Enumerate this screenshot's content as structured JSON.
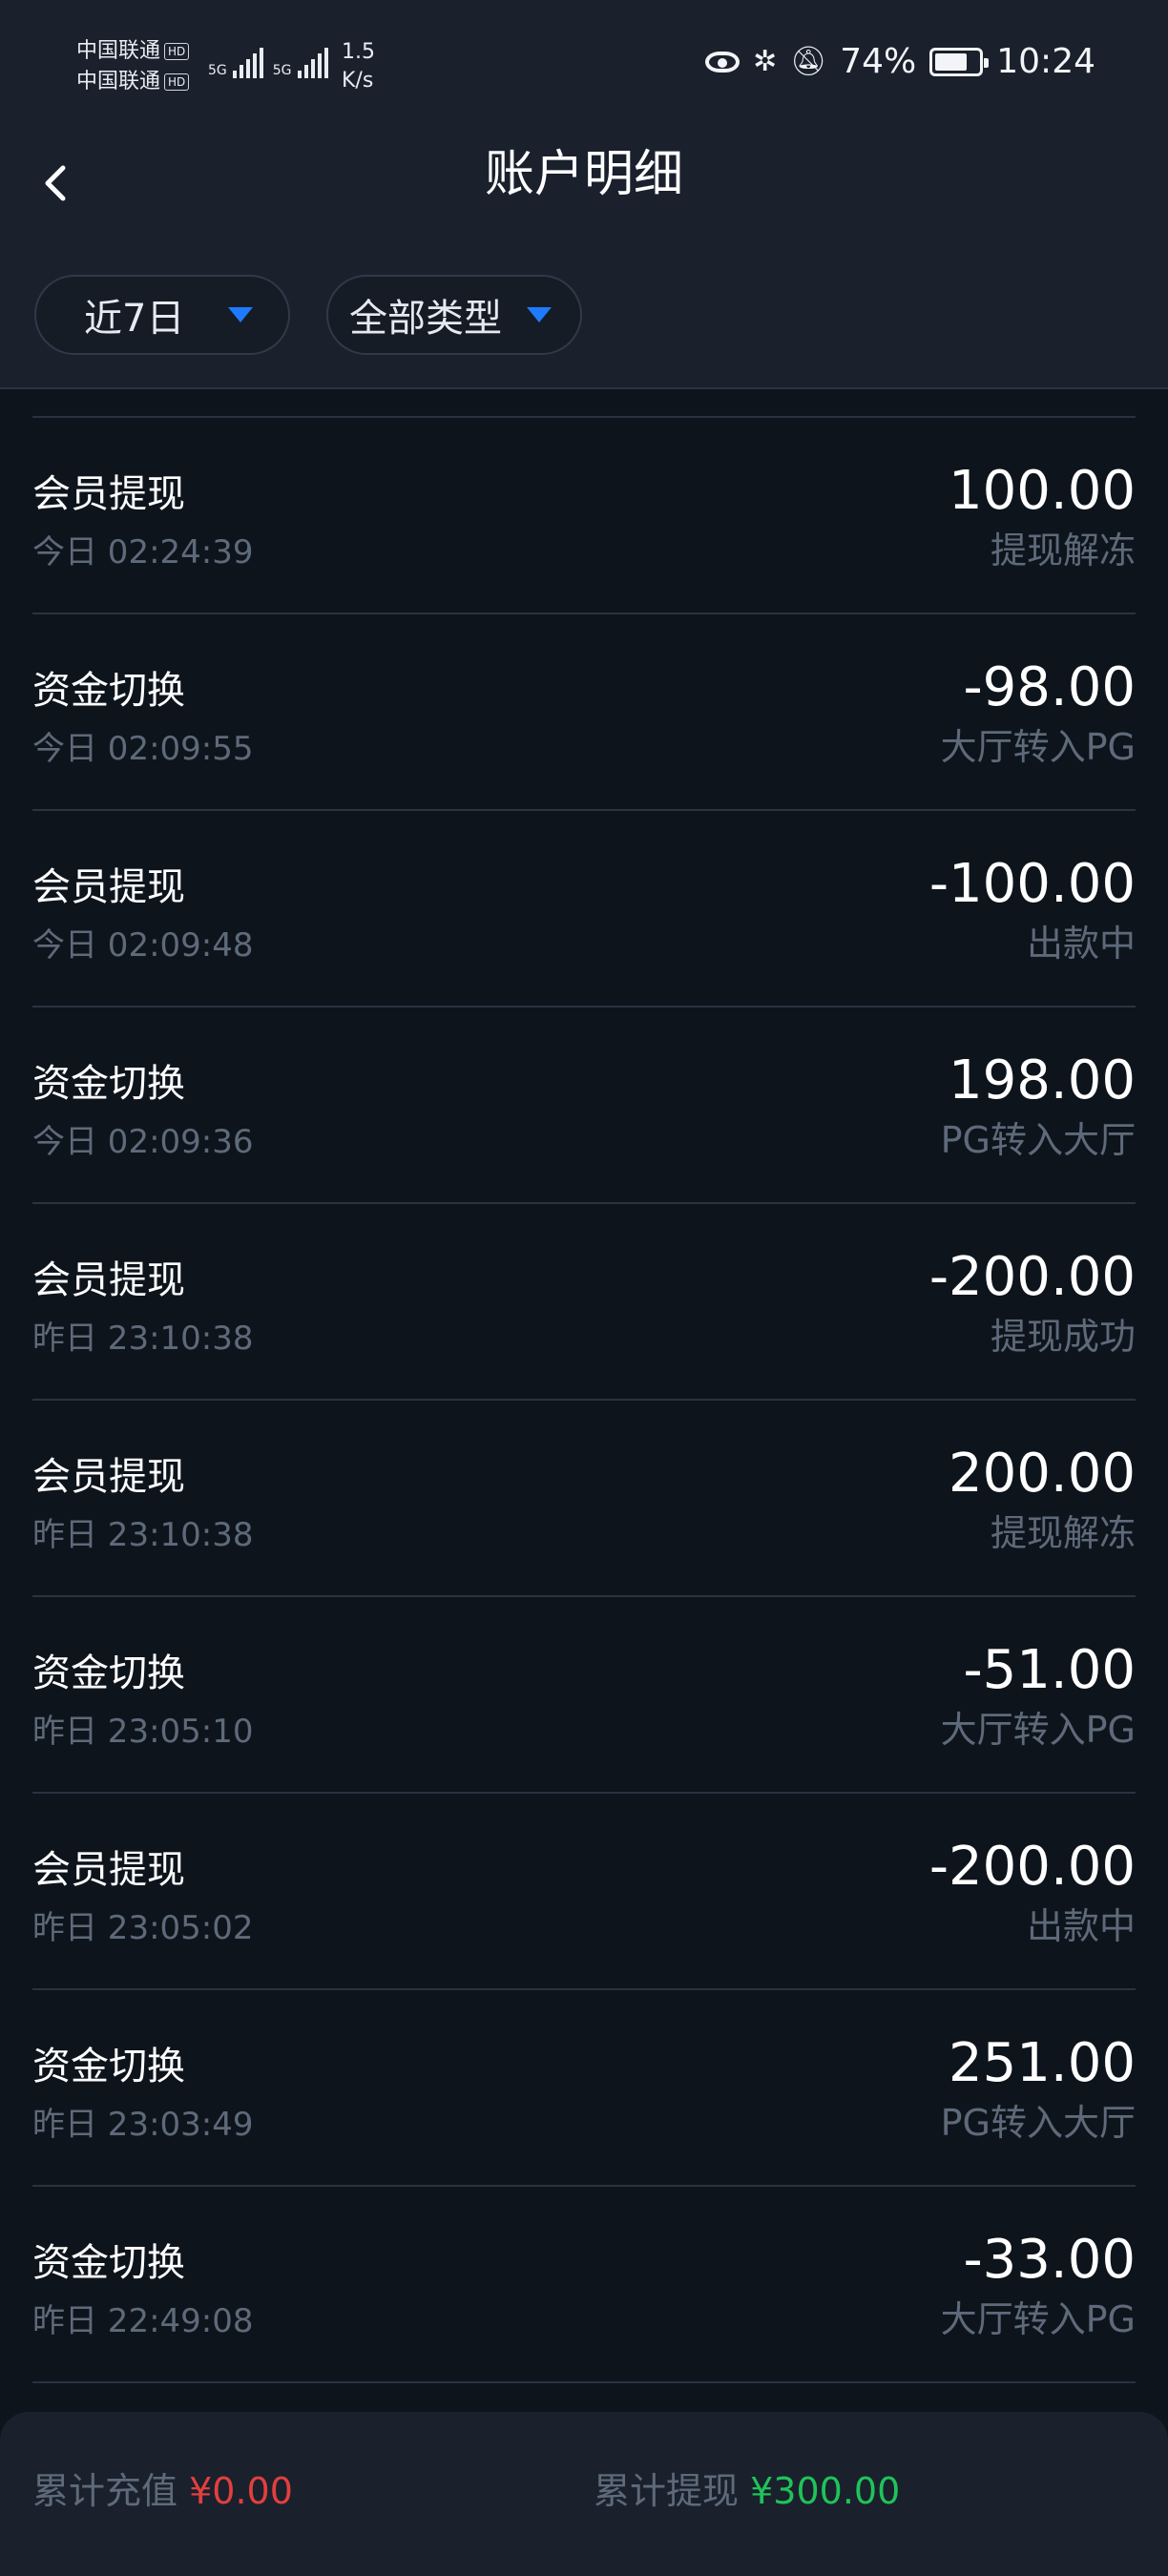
{
  "status_bar": {
    "carrier_1": "中国联通",
    "carrier_2": "中国联通",
    "hd_badge": "HD",
    "net_1": "5G",
    "net_2": "5G",
    "speed_value": "1.5",
    "speed_unit": "K/s",
    "battery_percent": "74%",
    "battery_level": 0.74,
    "time": "10:24",
    "icons": [
      "eye-icon",
      "bluetooth-icon",
      "vibrate-icon",
      "mute-bell-icon",
      "battery-icon"
    ]
  },
  "header": {
    "title": "账户明细",
    "back_icon": "chevron-left-icon"
  },
  "filters": {
    "period": "近7日",
    "type": "全部类型",
    "caret_color": "#1e7bff"
  },
  "records": [
    {
      "type": "会员提现",
      "time": "今日 02:24:39",
      "amount": "100.00",
      "status": "提现解冻"
    },
    {
      "type": "资金切换",
      "time": "今日 02:09:55",
      "amount": "-98.00",
      "status": "大厅转入PG"
    },
    {
      "type": "会员提现",
      "time": "今日 02:09:48",
      "amount": "-100.00",
      "status": "出款中"
    },
    {
      "type": "资金切换",
      "time": "今日 02:09:36",
      "amount": "198.00",
      "status": "PG转入大厅"
    },
    {
      "type": "会员提现",
      "time": "昨日 23:10:38",
      "amount": "-200.00",
      "status": "提现成功"
    },
    {
      "type": "会员提现",
      "time": "昨日 23:10:38",
      "amount": "200.00",
      "status": "提现解冻"
    },
    {
      "type": "资金切换",
      "time": "昨日 23:05:10",
      "amount": "-51.00",
      "status": "大厅转入PG"
    },
    {
      "type": "会员提现",
      "time": "昨日 23:05:02",
      "amount": "-200.00",
      "status": "出款中"
    },
    {
      "type": "资金切换",
      "time": "昨日 23:03:49",
      "amount": "251.00",
      "status": "PG转入大厅"
    },
    {
      "type": "资金切换",
      "time": "昨日 22:49:08",
      "amount": "-33.00",
      "status": "大厅转入PG"
    }
  ],
  "summary": {
    "recharge_label": "累计充值",
    "recharge_value": "¥0.00",
    "withdraw_label": "累计提现",
    "withdraw_value": "¥300.00",
    "recharge_color": "#e23f3f",
    "withdraw_color": "#1fc35a"
  }
}
